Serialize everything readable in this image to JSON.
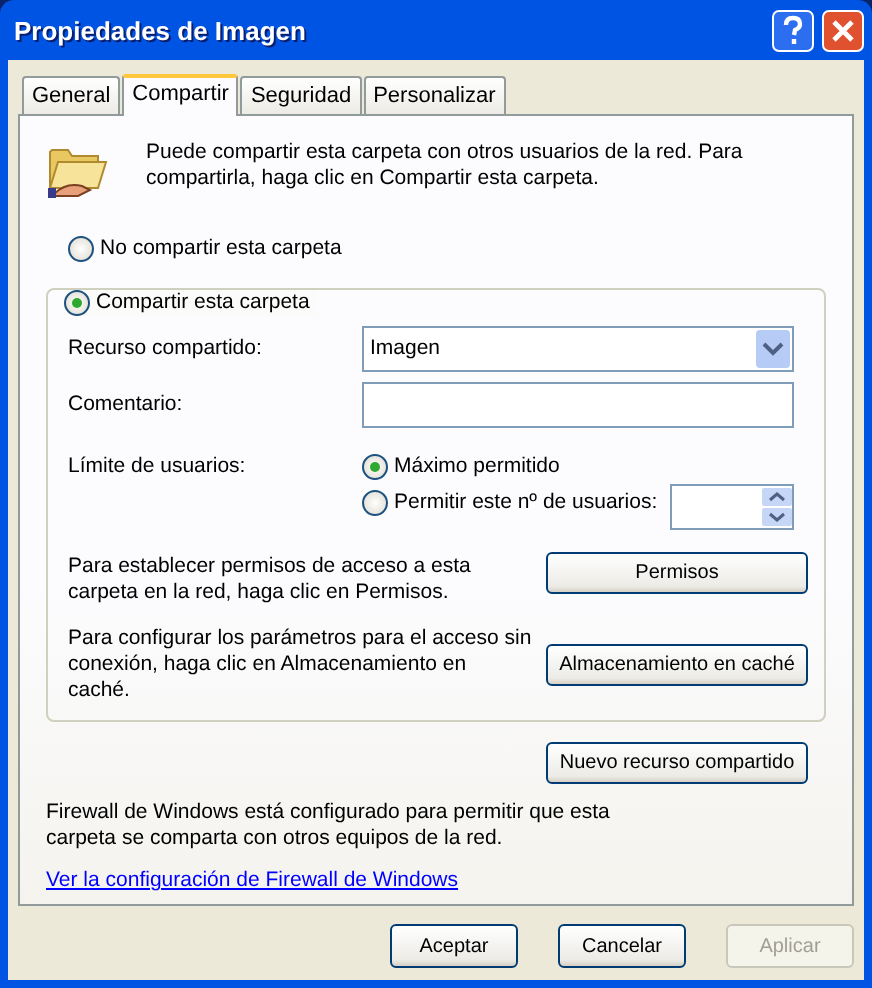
{
  "window": {
    "title": "Propiedades de Imagen"
  },
  "tabs": [
    {
      "label": "General",
      "selected": false
    },
    {
      "label": "Compartir",
      "selected": true
    },
    {
      "label": "Seguridad",
      "selected": false
    },
    {
      "label": "Personalizar",
      "selected": false
    }
  ],
  "intro": "Puede compartir esta carpeta con otros usuarios de la red. Para compartirla, haga clic en Compartir esta carpeta.",
  "share_options": [
    {
      "label": "No compartir esta carpeta",
      "selected": false
    },
    {
      "label": "Compartir esta carpeta",
      "selected": true
    }
  ],
  "share_name": {
    "label": "Recurso compartido:",
    "value": "Imagen"
  },
  "comment": {
    "label": "Comentario:"
  },
  "user_limit": {
    "label": "Límite de usuarios:",
    "options": [
      {
        "label": "Máximo permitido",
        "selected": true
      },
      {
        "label": "Permitir este nº de usuarios:",
        "selected": false
      }
    ]
  },
  "permissions": {
    "text": "Para establecer permisos de acceso a esta carpeta en la red, haga clic en Permisos.",
    "button": "Permisos"
  },
  "caching": {
    "text": "Para configurar los parámetros para el acceso sin conexión, haga clic en Almacenamiento en caché.",
    "button": "Almacenamiento en caché"
  },
  "new_share_button": "Nuevo recurso compartido",
  "firewall": {
    "text": "Firewall de Windows está configurado para permitir que esta carpeta se comparta con otros equipos de la red.",
    "link": "Ver la configuración de Firewall de Windows"
  },
  "buttons": [
    {
      "label": "Aceptar",
      "disabled": false
    },
    {
      "label": "Cancelar",
      "disabled": false
    },
    {
      "label": "Aplicar",
      "disabled": true
    }
  ]
}
